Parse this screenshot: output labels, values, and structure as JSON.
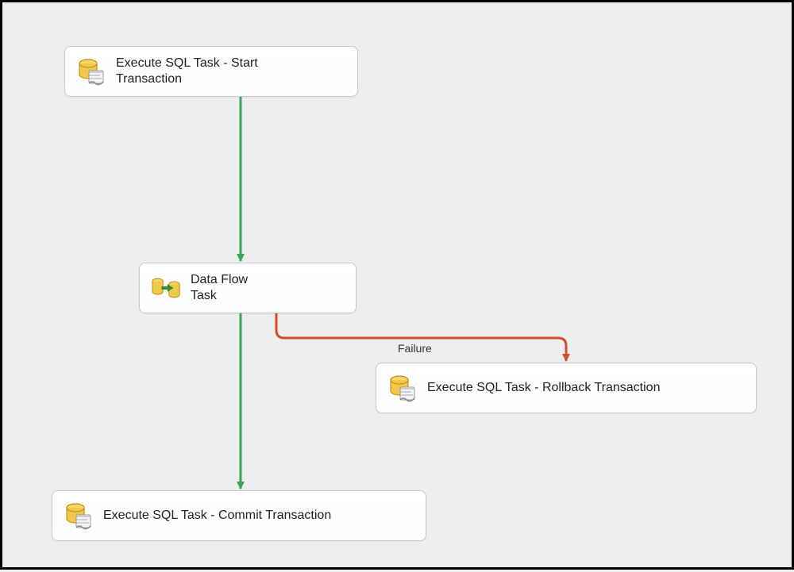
{
  "tasks": {
    "start": {
      "label": "Execute SQL Task - Start\nTransaction"
    },
    "dataflow": {
      "label": "Data Flow\nTask"
    },
    "commit": {
      "label": "Execute SQL Task - Commit Transaction"
    },
    "rollback": {
      "label": "Execute SQL Task - Rollback Transaction"
    }
  },
  "connectors": {
    "failure_label": "Failure"
  },
  "colors": {
    "success": "#3aa655",
    "failure": "#d64b2a"
  }
}
